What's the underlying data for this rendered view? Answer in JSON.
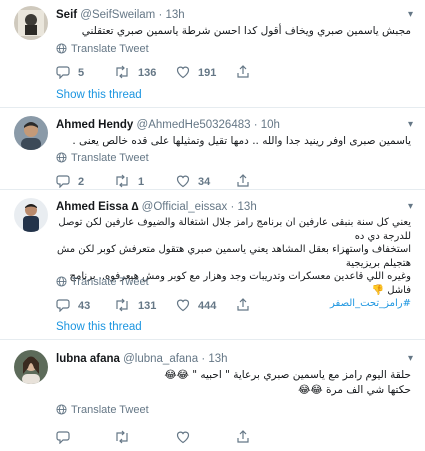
{
  "tweets": [
    {
      "name": "Seif",
      "handle": "@SeifSweilam",
      "dot": "·",
      "time": "13h",
      "text": "مجبش ياسمين صبري ويخاف أقول كدا احسن شرطة ياسمين صبري تعتقلني",
      "translate": "Translate Tweet",
      "replies": "5",
      "retweets": "136",
      "likes": "191",
      "show_thread": "Show this thread"
    },
    {
      "name": "Ahmed Hendy",
      "handle": "@AhmedHe50326483",
      "dot": "·",
      "time": "10h",
      "text": "ياسمين صبرى اوفر رينيد جدا والله .. دمها تقيل وتمثيلها على قده خالص يعنى .",
      "translate": "Translate Tweet",
      "replies": "2",
      "retweets": "1",
      "likes": "34"
    },
    {
      "name": "Ahmed Eissa ∆",
      "handle": "@Official_eissax",
      "dot": "·",
      "time": "13h",
      "text_lines": [
        "يعني كل سنة بنبقى عارفين ان برنامج رامز جلال اشتغالة والضيوف عارفين لكن توصل للدرجة دي ده",
        "استخفاف واستهزاء بعقل المشاهد يعني ياسمين صبري هتقول متعرفش كوبر لكن مش هتجيلم بريزيجية",
        "وغيره اللي قاعدين معسكرات وتدريبات وجد وهزار مع كوبر ومش هيعرفوه.. برنامج فاشل"
      ],
      "hashtag": "#رامز_تحت_الصفر",
      "translate": "Translate Tweet",
      "replies": "43",
      "retweets": "131",
      "likes": "444",
      "show_thread": "Show this thread"
    },
    {
      "name": "lubna afana",
      "handle": "@lubna_afana",
      "dot": "·",
      "time": "13h",
      "text_lines": [
        "حلقة اليوم رامز مع ياسمين صبري برعاية \" احبيه \" 😂😂",
        "حكتها شي الف مرة 😂😂"
      ],
      "translate": "Translate Tweet",
      "replies": "",
      "retweets": "",
      "likes": ""
    }
  ],
  "colors": {
    "accent": "#1b95e0",
    "muted": "#657786",
    "border": "#e6ecf0"
  }
}
